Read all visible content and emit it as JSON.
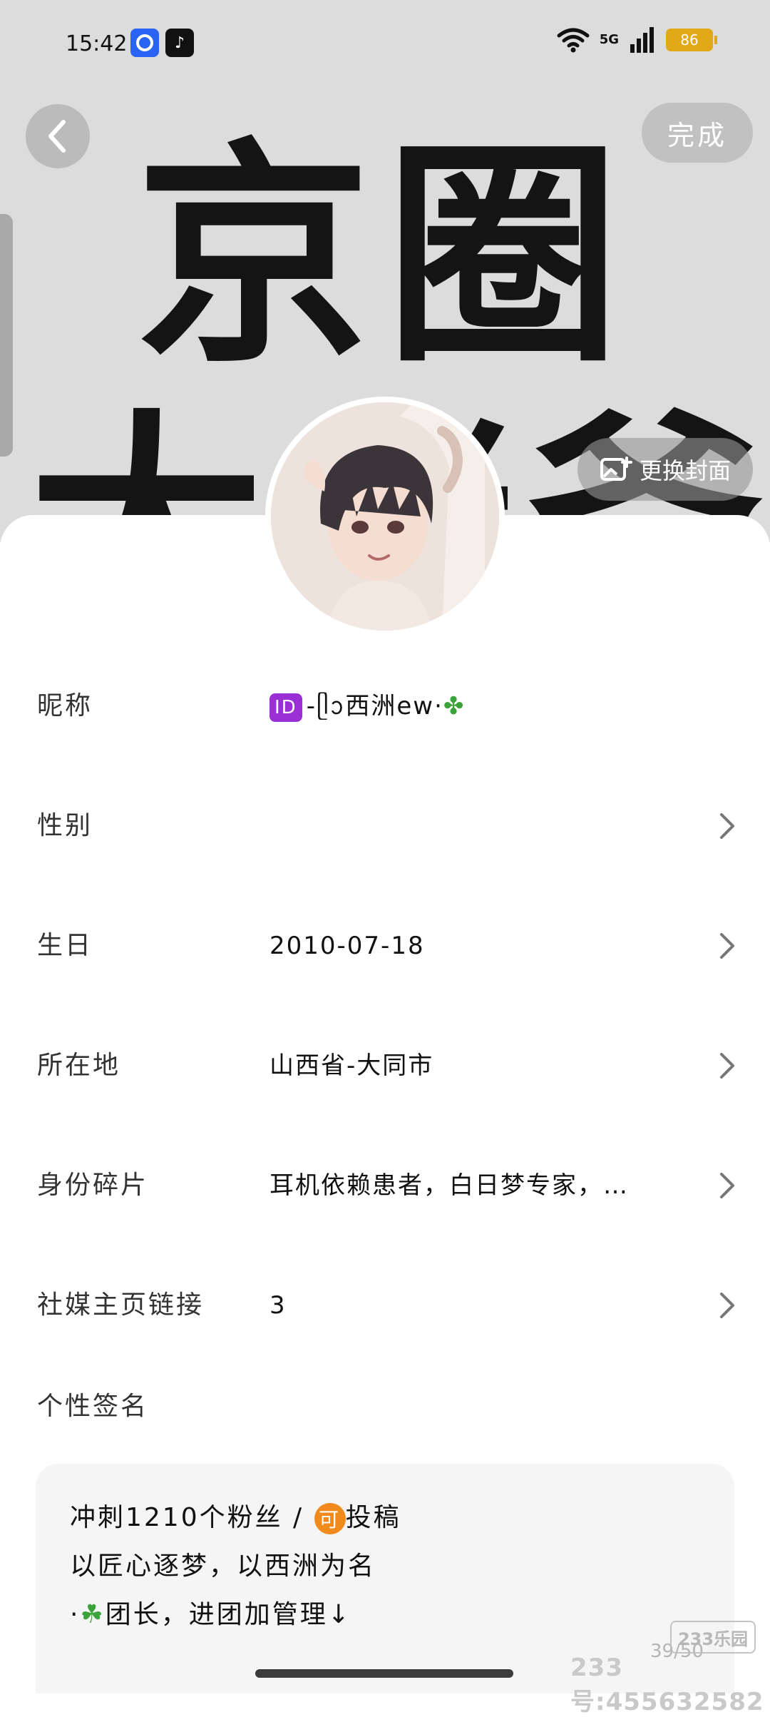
{
  "status_bar": {
    "time": "15:42",
    "network": "5G",
    "battery": "86"
  },
  "header": {
    "back_icon": "chevron-left-icon",
    "done_label": "完成",
    "change_cover_label": "更换封面",
    "cover_text_line1": "京圈",
    "cover_text_line2": "大佬爷"
  },
  "profile": {
    "rows": [
      {
        "label": "昵称",
        "value": "-ᥫᩣ西洲ew·",
        "badge": "ID",
        "has_chevron": false
      },
      {
        "label": "性别",
        "value": "",
        "has_chevron": true
      },
      {
        "label": "生日",
        "value": "2010-07-18",
        "has_chevron": true
      },
      {
        "label": "所在地",
        "value": "山西省-大同市",
        "has_chevron": true
      },
      {
        "label": "身份碎片",
        "value": "耳机依赖患者，白日梦专家，…",
        "has_chevron": true
      },
      {
        "label": "社媒主页链接",
        "value": "3",
        "has_chevron": true
      }
    ],
    "signature_title": "个性签名",
    "signature_lines": [
      {
        "before": "冲刺1210个粉丝 /",
        "badge": "可",
        "after": "投稿"
      },
      {
        "text": "以匠心逐梦，以西洲为名"
      },
      {
        "prefix": "·",
        "clover": "☘",
        "text": "团长，进团加管理↓"
      }
    ],
    "signature_counter": "39/50"
  },
  "watermark": {
    "logo": "233乐园",
    "text": "233号:455632582"
  },
  "colors": {
    "battery": "#e3a817",
    "id_badge": "#9b2fd6",
    "orange_badge": "#f08a1c",
    "clover": "#3aa33a"
  }
}
